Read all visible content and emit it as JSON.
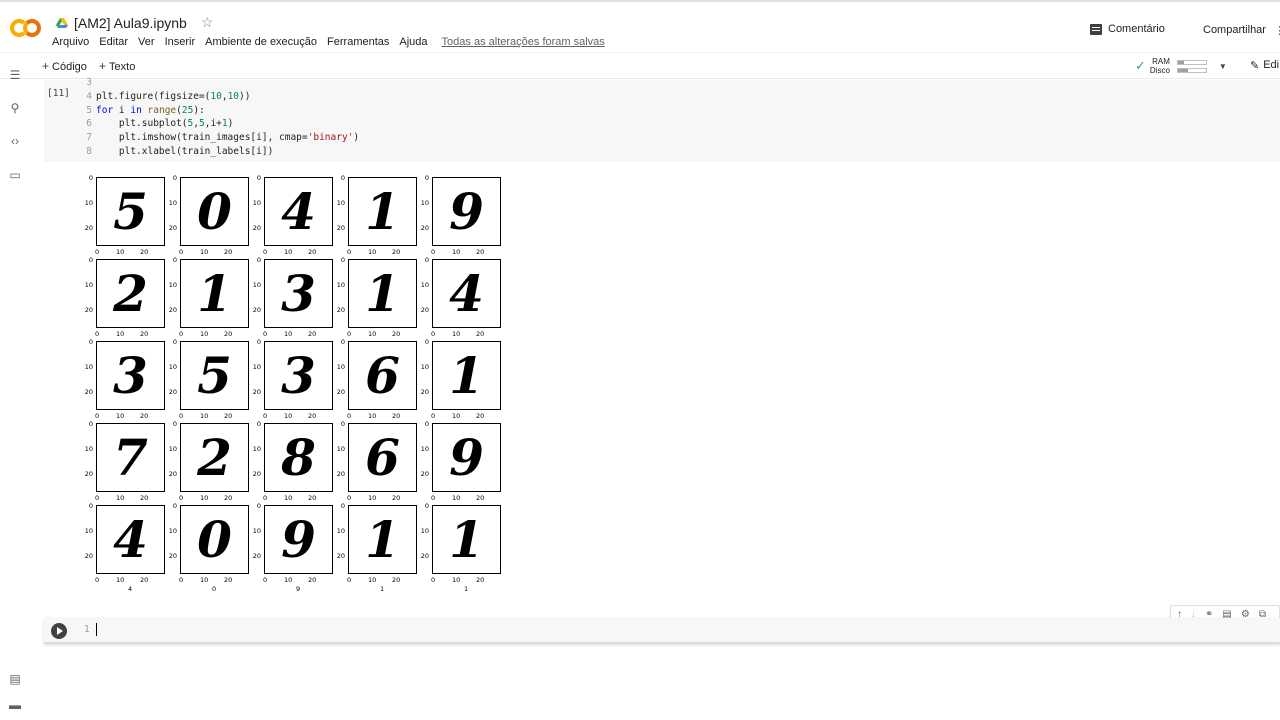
{
  "header": {
    "notebook_title": "[AM2] Aula9.ipynb",
    "menu": [
      "Arquivo",
      "Editar",
      "Ver",
      "Inserir",
      "Ambiente de execução",
      "Ferramentas",
      "Ajuda"
    ],
    "save_status": "Todas as alterações foram salvas",
    "comment_label": "Comentário",
    "share_label": "Compartilhar"
  },
  "toolbar": {
    "add_code": "Código",
    "add_text": "Texto",
    "ram_label": "RAM",
    "disk_label": "Disco",
    "ram_usage": 0.2,
    "disk_usage": 0.35,
    "edit_label": "Edi"
  },
  "sidebar": {
    "icons": [
      "toc-icon",
      "search-icon",
      "code-snippets-icon",
      "files-icon"
    ],
    "bottom_icons": [
      "command-palette-icon",
      "terminal-icon"
    ]
  },
  "cell": {
    "exec_count": "[11]",
    "lines": [
      {
        "n": "3",
        "code": ""
      },
      {
        "n": "4",
        "code": "plt.figure(figsize=(10,10))"
      },
      {
        "n": "5",
        "code": "for i in range(25):"
      },
      {
        "n": "6",
        "code": "    plt.subplot(5,5,i+1)"
      },
      {
        "n": "7",
        "code": "    plt.imshow(train_images[i], cmap='binary')"
      },
      {
        "n": "8",
        "code": "    plt.xlabel(train_labels[i])"
      }
    ]
  },
  "output": {
    "digits": [
      "5",
      "0",
      "4",
      "1",
      "9",
      "2",
      "1",
      "3",
      "1",
      "4",
      "3",
      "5",
      "3",
      "6",
      "1",
      "7",
      "2",
      "8",
      "6",
      "9",
      "4",
      "0",
      "9",
      "1",
      "1"
    ],
    "y_ticks": [
      "0",
      "10",
      "20"
    ],
    "x_ticks": [
      "0",
      "10",
      "20"
    ],
    "visible_xlabels": [
      "4",
      "0",
      "9",
      "1",
      "1"
    ]
  },
  "new_cell": {
    "line_number": "1"
  }
}
